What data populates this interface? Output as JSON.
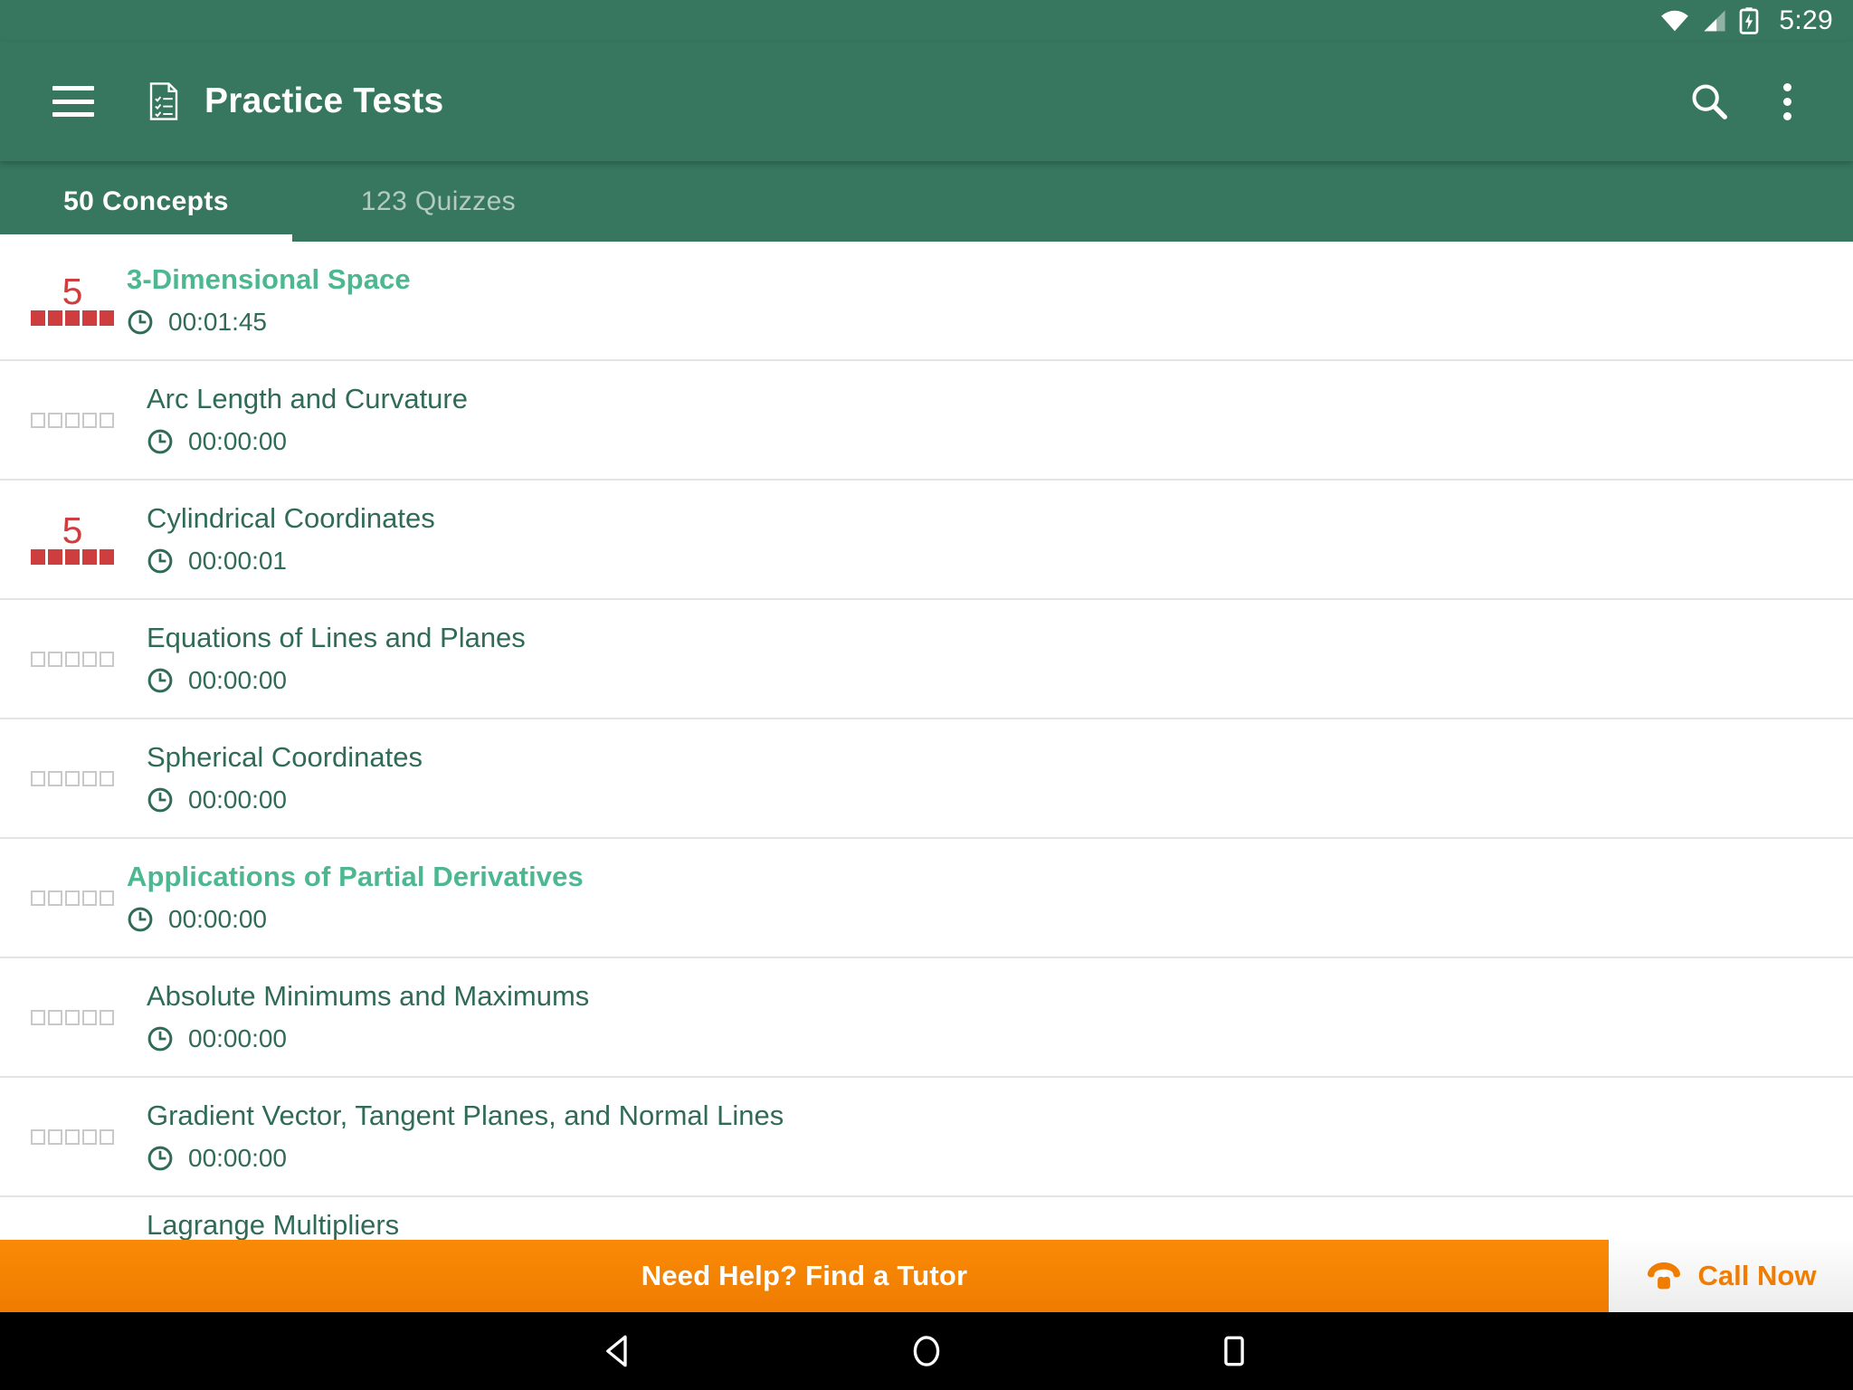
{
  "status_bar": {
    "time": "5:29",
    "icons": [
      "wifi-icon",
      "cellular-signal-icon",
      "battery-charging-icon"
    ]
  },
  "app_bar": {
    "menu_icon": "hamburger-menu-icon",
    "app_icon": "document-checklist-icon",
    "title": "Practice Tests",
    "search_icon": "search-icon",
    "overflow_icon": "overflow-menu-icon"
  },
  "tabs": [
    {
      "label": "50 Concepts",
      "active": true
    },
    {
      "label": "123 Quizzes",
      "active": false
    }
  ],
  "list": [
    {
      "title": "3-Dimensional Space",
      "type": "section",
      "time": "00:01:45",
      "rating": 5,
      "rating_label": "5"
    },
    {
      "title": "Arc Length and Curvature",
      "type": "item",
      "time": "00:00:00",
      "rating": 0,
      "rating_label": ""
    },
    {
      "title": "Cylindrical Coordinates",
      "type": "item",
      "time": "00:00:01",
      "rating": 5,
      "rating_label": "5"
    },
    {
      "title": "Equations of Lines and Planes",
      "type": "item",
      "time": "00:00:00",
      "rating": 0,
      "rating_label": ""
    },
    {
      "title": "Spherical Coordinates",
      "type": "item",
      "time": "00:00:00",
      "rating": 0,
      "rating_label": ""
    },
    {
      "title": "Applications of Partial Derivatives",
      "type": "section",
      "time": "00:00:00",
      "rating": 0,
      "rating_label": ""
    },
    {
      "title": "Absolute Minimums and Maximums",
      "type": "item",
      "time": "00:00:00",
      "rating": 0,
      "rating_label": ""
    },
    {
      "title": "Gradient Vector, Tangent Planes, and Normal Lines",
      "type": "item",
      "time": "00:00:00",
      "rating": 0,
      "rating_label": ""
    },
    {
      "title": "Lagrange Multipliers",
      "type": "item",
      "time": "",
      "rating": 0,
      "rating_label": ""
    }
  ],
  "banner": {
    "message": "Need Help? Find a Tutor",
    "call_label": "Call Now",
    "phone_icon": "telephone-icon"
  },
  "nav_bar": {
    "back_icon": "back-triangle-icon",
    "home_icon": "home-circle-icon",
    "recents_icon": "recents-square-icon"
  },
  "colors": {
    "primary_green": "#37765f",
    "section_green": "#4cb791",
    "item_green": "#2f6b57",
    "rating_red": "#cf3e3e",
    "banner_orange": "#f07c00",
    "divider": "#e3e3e3"
  }
}
